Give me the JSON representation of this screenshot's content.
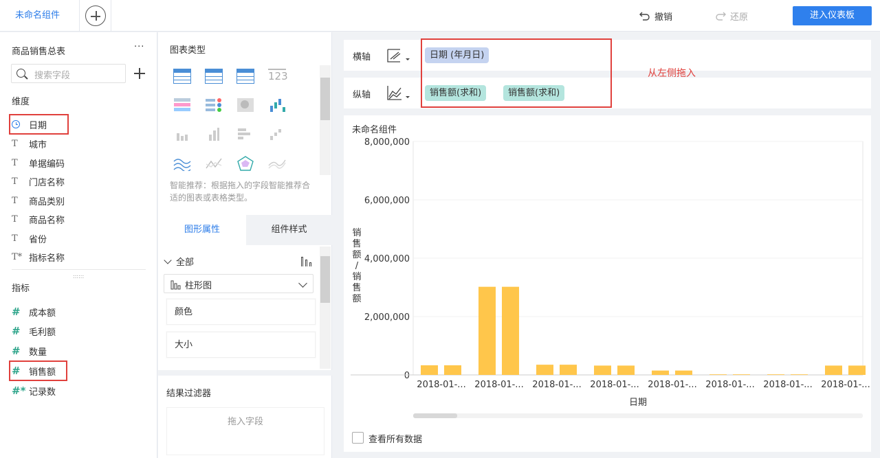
{
  "topbar": {
    "active_tab": "未命名组件",
    "undo": "撤销",
    "redo": "还原",
    "enter_dashboard": "进入仪表板"
  },
  "left": {
    "table_name": "商品销售总表",
    "more": "···",
    "search_placeholder": "搜索字段",
    "dimensions_title": "维度",
    "dimensions": [
      "日期",
      "城市",
      "单据编码",
      "门店名称",
      "商品类别",
      "商品名称",
      "省份",
      "指标名称"
    ],
    "measures_title": "指标",
    "measures": [
      "成本额",
      "毛利额",
      "数量",
      "销售额",
      "记录数"
    ]
  },
  "middle": {
    "chart_types_title": "图表类型",
    "hint": "智能推荐：根据拖入的字段智能推荐合适的图表或表格类型。",
    "tab_properties": "图形属性",
    "tab_style": "组件样式",
    "all_label": "全部",
    "chart_select": "柱形图",
    "prop_color": "颜色",
    "prop_size": "大小",
    "filter_title": "结果过滤器",
    "filter_drop": "拖入字段"
  },
  "axes": {
    "x_label": "横轴",
    "y_label": "纵轴",
    "x_pill": "日期 (年月日)",
    "y_pills": [
      "销售额(求和)",
      "销售额(求和)"
    ],
    "annotation": "从左侧拖入"
  },
  "chart_panel": {
    "title": "未命名组件",
    "view_all": "查看所有数据"
  },
  "chart_data": {
    "type": "bar",
    "title": "",
    "xlabel": "日期",
    "ylabel": "销售额/销售额",
    "ylim": [
      0,
      8000000
    ],
    "yticks": [
      "8,000,000",
      "6,000,000",
      "4,000,000",
      "2,000,000",
      "0"
    ],
    "categories": [
      "2018-01-...",
      "2018-01-...",
      "2018-01-...",
      "2018-01-...",
      "2018-01-...",
      "2018-01-...",
      "2018-01-...",
      "2018-01-..."
    ],
    "series": [
      {
        "values": [
          330000,
          3020000,
          350000,
          320000,
          150000,
          20000,
          20000,
          320000
        ]
      },
      {
        "values": [
          330000,
          3020000,
          350000,
          320000,
          150000,
          20000,
          20000,
          320000
        ]
      }
    ],
    "color": "#ffc64b"
  }
}
